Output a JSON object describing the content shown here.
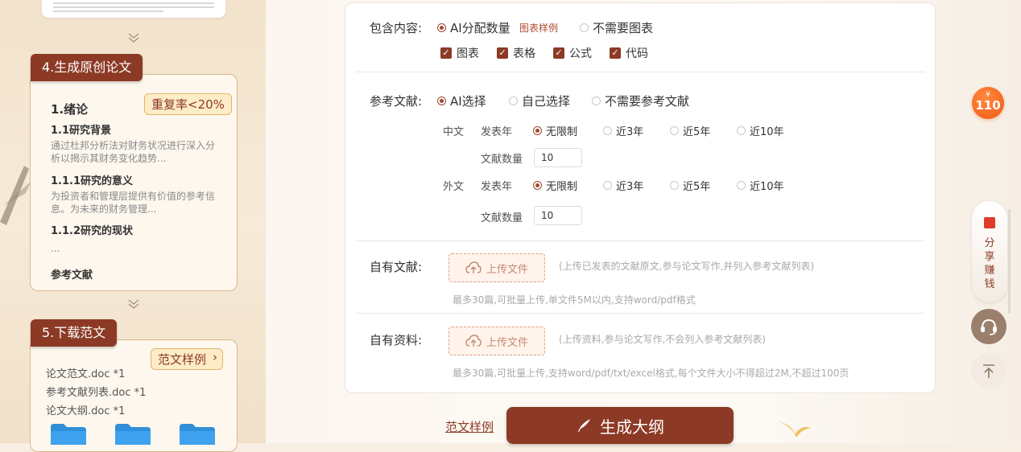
{
  "steps": {
    "step4": {
      "label": "4.生成原创论文",
      "badge": "重复率<20%",
      "outline": {
        "h1": "1.绪论",
        "s1": "1.1研究背景",
        "s1_text": "通过杜邦分析法对财务状况进行深入分析以揭示其财务变化趋势...",
        "s2": "1.1.1研究的意义",
        "s2_text": "为投资者和管理层提供有价值的参考信息。为未来的财务管理...",
        "s3": "1.1.2研究的现状",
        "ellipsis": "...",
        "refs": "参考文献"
      }
    },
    "step5": {
      "label": "5.下载范文",
      "sample_button": "范文样例",
      "files": [
        "论文范文.doc *1",
        "参考文献列表.doc *1",
        "论文大纲.doc *1"
      ]
    }
  },
  "form": {
    "content": {
      "label": "包含内容:",
      "opt_ai": "AI分配数量",
      "chart_sample_link": "图表样例",
      "opt_none": "不需要图表",
      "checkboxes": [
        "图表",
        "表格",
        "公式",
        "代码"
      ]
    },
    "references": {
      "label": "参考文献:",
      "opt_ai": "AI选择",
      "opt_self": "自己选择",
      "opt_none": "不需要参考文献",
      "cn": {
        "lang": "中文",
        "year_label": "发表年",
        "options": [
          "无限制",
          "近3年",
          "近5年",
          "近10年"
        ],
        "count_label": "文献数量",
        "count": "10"
      },
      "en": {
        "lang": "外文",
        "year_label": "发表年",
        "options": [
          "无限制",
          "近3年",
          "近5年",
          "近10年"
        ],
        "count_label": "文献数量",
        "count": "10"
      }
    },
    "own_refs": {
      "label": "自有文献:",
      "upload": "上传文件",
      "hint": "(上传已发表的文献原文,参与论文写作,并列入参考文献列表)",
      "note": "最多30篇,可批量上传,单文件5M以内,支持word/pdf格式"
    },
    "own_materials": {
      "label": "自有资料:",
      "upload": "上传文件",
      "hint": "(上传资料,参与论文写作,不会列入参考文献列表)",
      "note": "最多30篇,可批量上传,支持word/pdf/txt/excel格式,每个文件大小不得超过2M,不超过100页"
    }
  },
  "actions": {
    "sample_link": "范文样例",
    "generate": "生成大纲"
  },
  "floating": {
    "coin_symbol": "¥",
    "coin_value": "110",
    "share_text": [
      "分",
      "享",
      "赚",
      "钱"
    ]
  },
  "colors": {
    "brand": "#8c3a26",
    "accent_orange": "#f05a14",
    "badge_bg": "#fdecc8"
  }
}
